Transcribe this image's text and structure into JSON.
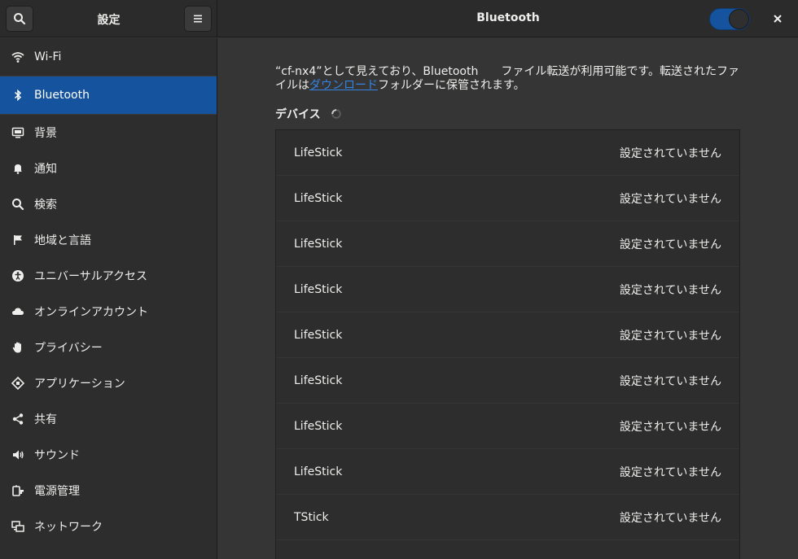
{
  "header": {
    "sidebar_title": "設定",
    "main_title": "Bluetooth",
    "bluetooth_enabled": true
  },
  "sidebar": {
    "items": [
      {
        "label": "Wi-Fi",
        "icon": "wifi-icon"
      },
      {
        "label": "Bluetooth",
        "icon": "bluetooth-icon",
        "active": true
      },
      {
        "label": "背景",
        "icon": "background-icon"
      },
      {
        "label": "通知",
        "icon": "bell-icon"
      },
      {
        "label": "検索",
        "icon": "search-icon"
      },
      {
        "label": "地域と言語",
        "icon": "flag-icon"
      },
      {
        "label": "ユニバーサルアクセス",
        "icon": "accessibility-icon"
      },
      {
        "label": "オンラインアカウント",
        "icon": "cloud-icon"
      },
      {
        "label": "プライバシー",
        "icon": "hand-icon"
      },
      {
        "label": "アプリケーション",
        "icon": "applications-icon"
      },
      {
        "label": "共有",
        "icon": "share-icon"
      },
      {
        "label": "サウンド",
        "icon": "speaker-icon"
      },
      {
        "label": "電源管理",
        "icon": "power-icon"
      },
      {
        "label": "ネットワーク",
        "icon": "network-icon"
      }
    ]
  },
  "main": {
    "desc_part1": "“cf-nx4”として見えており、Bluetooth　　ファイル転送が利用可能です。転送されたファイルは",
    "desc_link": "ダウンロード",
    "desc_part2": "フォルダーに保管されます。",
    "devices_label": "デバイス",
    "devices": [
      {
        "name": "LifeStick",
        "status": "設定されていません"
      },
      {
        "name": "LifeStick",
        "status": "設定されていません"
      },
      {
        "name": "LifeStick",
        "status": "設定されていません"
      },
      {
        "name": "LifeStick",
        "status": "設定されていません"
      },
      {
        "name": "LifeStick",
        "status": "設定されていません"
      },
      {
        "name": "LifeStick",
        "status": "設定されていません"
      },
      {
        "name": "LifeStick",
        "status": "設定されていません"
      },
      {
        "name": "LifeStick",
        "status": "設定されていません"
      },
      {
        "name": "TStick",
        "status": "設定されていません"
      },
      {
        "name": "",
        "status": ""
      }
    ]
  },
  "colors": {
    "accent": "#15539e",
    "link": "#3584e4",
    "background": "#353535",
    "sidebar": "#2d2d2d"
  }
}
